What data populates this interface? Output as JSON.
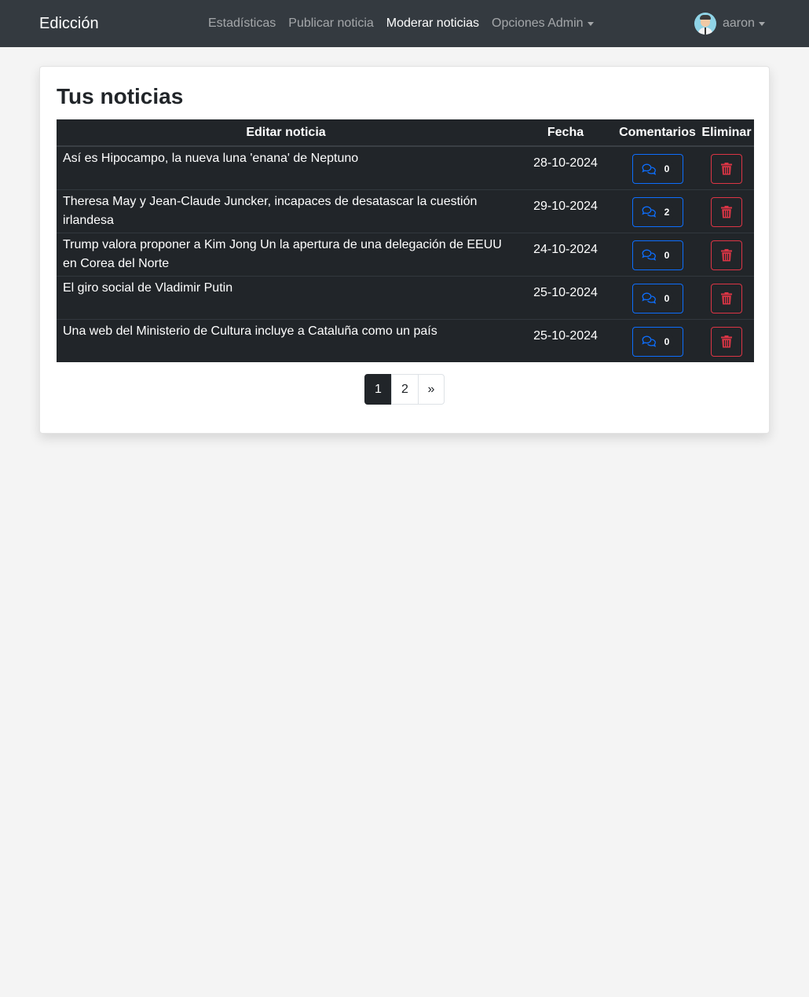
{
  "navbar": {
    "brand": "Edicción",
    "links": [
      {
        "label": "Estadísticas"
      },
      {
        "label": "Publicar noticia"
      },
      {
        "label": "Moderar noticias"
      },
      {
        "label": "Opciones Admin"
      }
    ],
    "user": "aaron"
  },
  "main": {
    "heading": "Tus noticias",
    "columns": [
      "Editar noticia",
      "Fecha",
      "Comentarios",
      "Eliminar"
    ],
    "rows": [
      {
        "title": "Así es Hipocampo, la nueva luna 'enana' de Neptuno",
        "date": "28-10-2024",
        "comments": "0"
      },
      {
        "title": "Theresa May y Jean-Claude Juncker, incapaces de desatascar la cuestión irlandesa",
        "date": "29-10-2024",
        "comments": "2"
      },
      {
        "title": "Trump valora proponer a Kim Jong Un la apertura de una delegación de EEUU en Corea del Norte",
        "date": "24-10-2024",
        "comments": "0"
      },
      {
        "title": "El giro social de Vladimir Putin",
        "date": "25-10-2024",
        "comments": "0"
      },
      {
        "title": "Una web del Ministerio de Cultura incluye a Cataluña como un país",
        "date": "25-10-2024",
        "comments": "0"
      }
    ],
    "pagination": [
      "1",
      "2",
      "»"
    ],
    "active_page": "1"
  },
  "colors": {
    "navbar_bg": "#343a40",
    "table_bg": "#212529",
    "primary": "#0d6efd",
    "danger": "#dc3545",
    "page_bg": "#f4f4f4"
  },
  "icons": {
    "comments": "comments-icon",
    "delete": "trash-icon",
    "avatar": "user-avatar"
  }
}
